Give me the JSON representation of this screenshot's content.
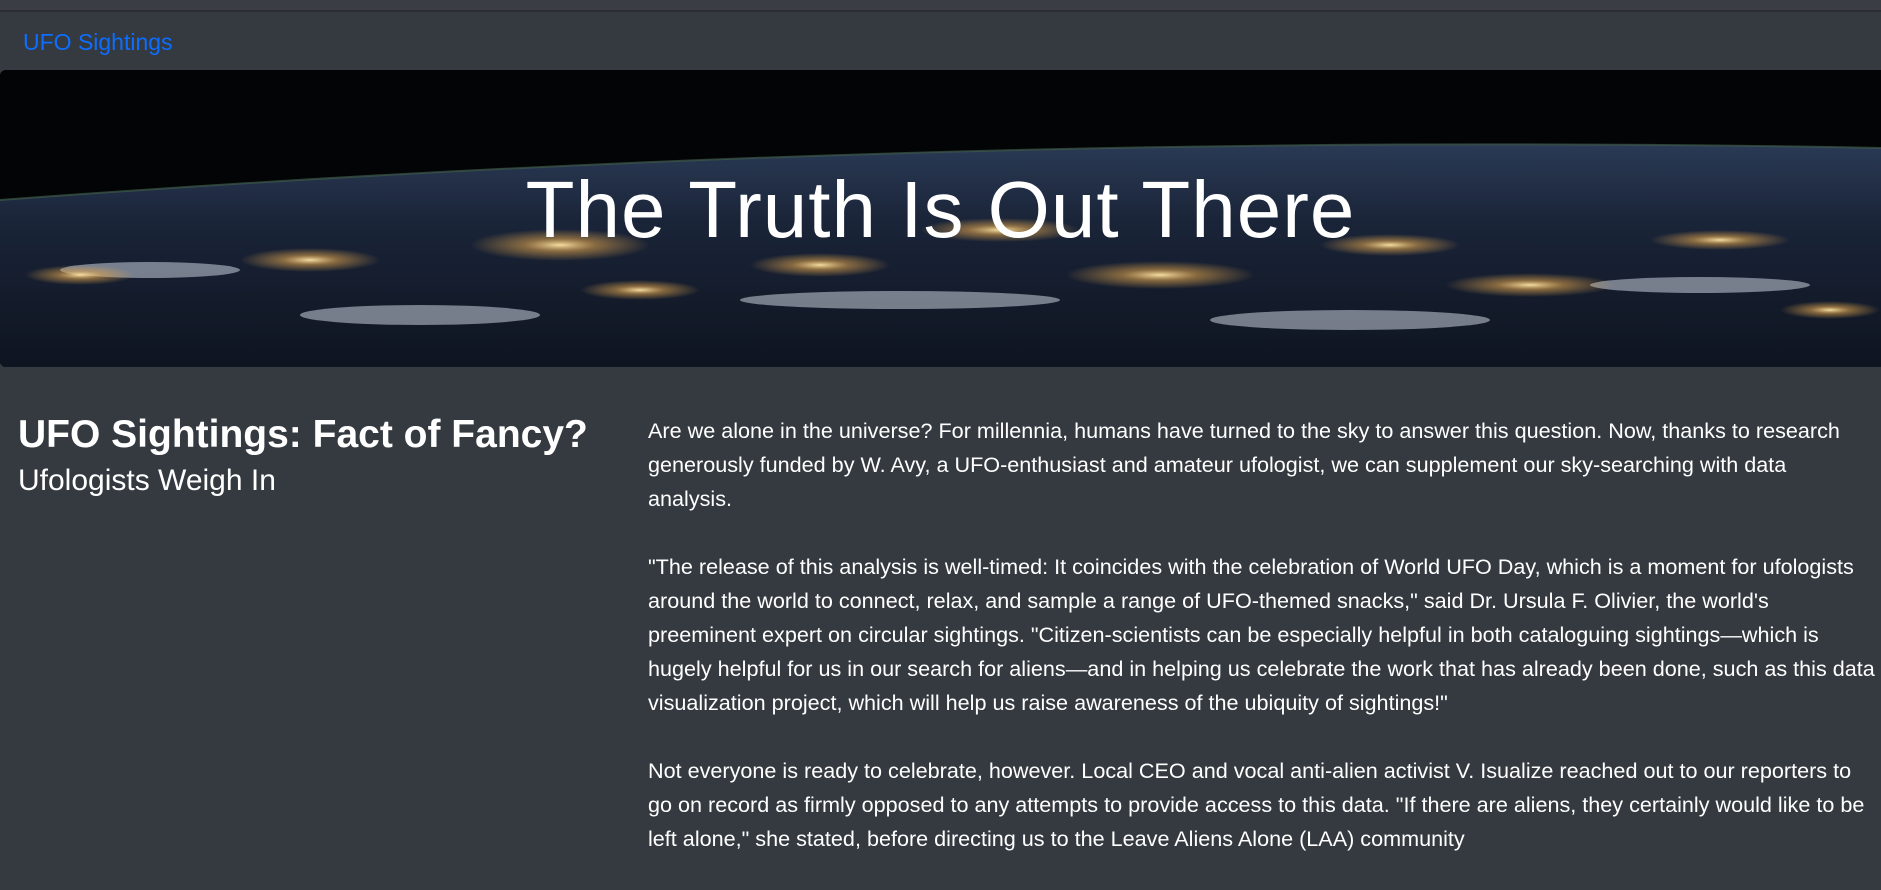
{
  "navbar": {
    "brand": "UFO Sightings"
  },
  "hero": {
    "title": "The Truth Is Out There"
  },
  "article": {
    "title": "UFO Sightings: Fact of Fancy?",
    "subtitle": "Ufologists Weigh In",
    "paragraphs": [
      "Are we alone in the universe? For millennia, humans have turned to the sky to answer this question. Now, thanks to research generously funded by W. Avy, a UFO-enthusiast and amateur ufologist, we can supplement our sky-searching with data analysis.",
      "\"The release of this analysis is well-timed: It coincides with the celebration of World UFO Day, which is a moment for ufologists around the world to connect, relax, and sample a range of UFO-themed snacks,\" said Dr. Ursula F. Olivier, the world's preeminent expert on circular sightings. \"Citizen-scientists can be especially helpful in both cataloguing sightings—which is hugely helpful for us in our search for aliens—and in helping us celebrate the work that has already been done, such as this data visualization project, which will help us raise awareness of the ubiquity of sightings!\"",
      "Not everyone is ready to celebrate, however. Local CEO and vocal anti-alien activist V. Isualize reached out to our reporters to go on record as firmly opposed to any attempts to provide access to this data. \"If there are aliens, they certainly would like to be left alone,\" she stated, before directing us to the Leave Aliens Alone (LAA) community"
    ]
  },
  "colors": {
    "background": "#343a40",
    "brand_link": "#0d6efd",
    "text": "#ffffff"
  }
}
